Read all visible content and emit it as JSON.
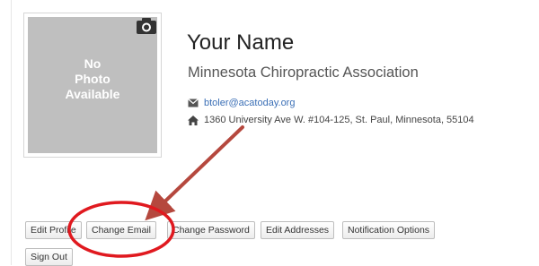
{
  "profile": {
    "photo_placeholder": [
      "No",
      "Photo",
      "Available"
    ],
    "camera_icon": "camera-icon",
    "name": "Your Name",
    "organization": "Minnesota Chiropractic Association",
    "email": "btoler@acatoday.org",
    "email_icon": "envelope-icon",
    "address": "1360 University Ave W. #104-125, St. Paul, Minnesota, 55104",
    "address_icon": "home-icon"
  },
  "actions": {
    "edit_profile": "Edit Profile",
    "change_email": "Change Email",
    "change_password": "Change Password",
    "edit_addresses": "Edit Addresses",
    "notification_options": "Notification Options",
    "sign_out": "Sign Out"
  },
  "annotation": {
    "highlight_color": "#e0191f",
    "arrow_color": "#b5483e"
  }
}
